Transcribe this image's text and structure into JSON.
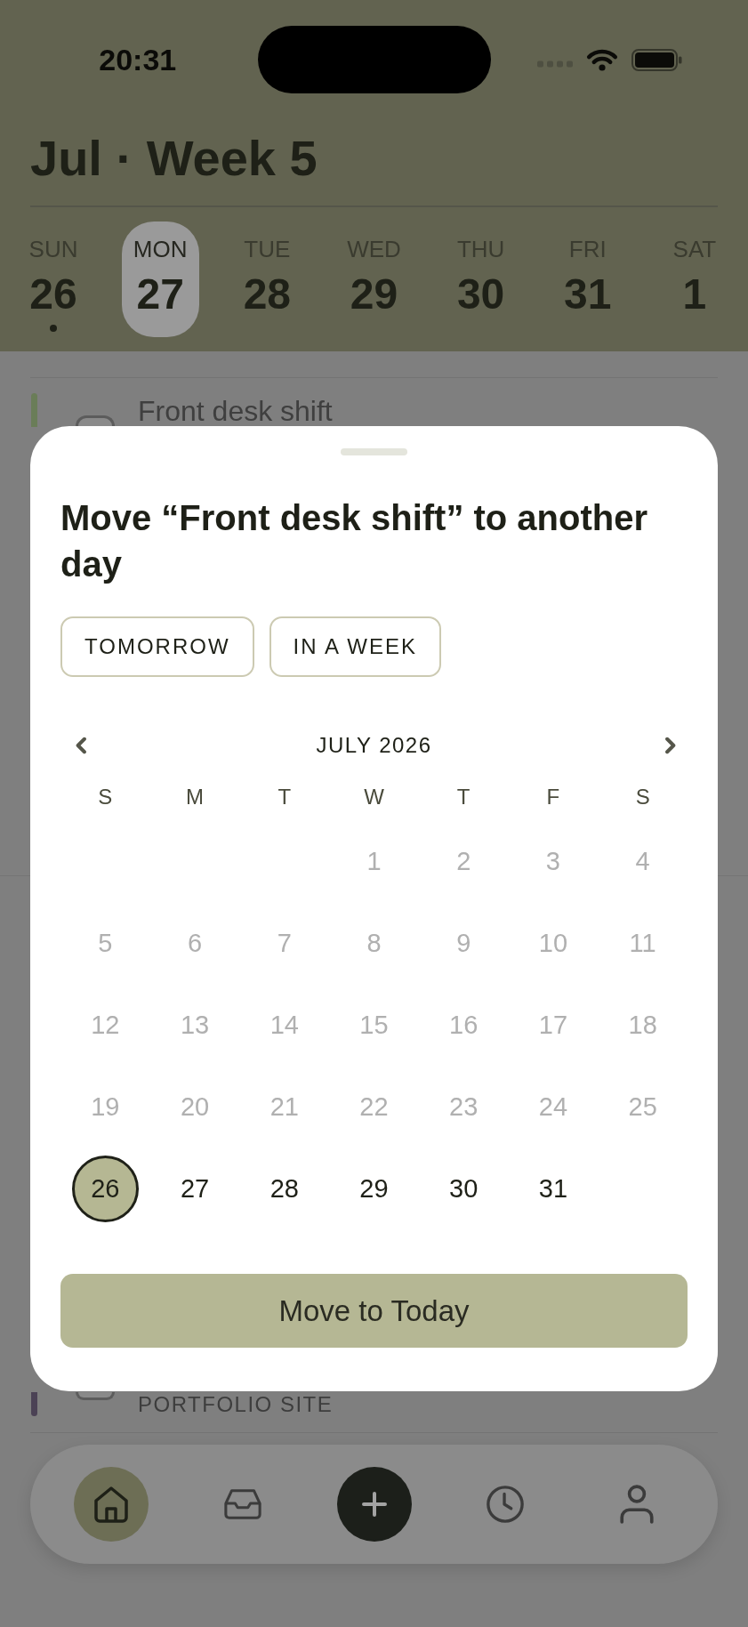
{
  "status_bar": {
    "time": "20:31"
  },
  "header": {
    "title": "Jul · Week 5",
    "days": [
      {
        "label": "SUN",
        "number": "26",
        "selected": false,
        "marked": true
      },
      {
        "label": "MON",
        "number": "27",
        "selected": true,
        "marked": false
      },
      {
        "label": "TUE",
        "number": "28",
        "selected": false,
        "marked": false
      },
      {
        "label": "WED",
        "number": "29",
        "selected": false,
        "marked": false
      },
      {
        "label": "THU",
        "number": "30",
        "selected": false,
        "marked": false
      },
      {
        "label": "FRI",
        "number": "31",
        "selected": false,
        "marked": false
      },
      {
        "label": "SAT",
        "number": "1",
        "selected": false,
        "marked": false
      }
    ]
  },
  "agenda": {
    "tasks": [
      {
        "title": "Front desk shift",
        "color": "#6a7d58",
        "checked": false
      },
      {
        "project": "PORTFOLIO SITE",
        "color": "#4b4255",
        "checked": false
      }
    ]
  },
  "move_sheet": {
    "title": "Move “Front desk shift” to another day",
    "quick_options": [
      {
        "label": "TOMORROW"
      },
      {
        "label": "IN A WEEK"
      }
    ],
    "calendar": {
      "month": "JULY 2026",
      "weekdays": [
        "S",
        "M",
        "T",
        "W",
        "T",
        "F",
        "S"
      ],
      "weeks": [
        {
          "days": [
            {
              "day": "1",
              "disabled": true,
              "selected": false
            },
            {
              "day": "2",
              "disabled": true,
              "selected": false
            },
            {
              "day": "3",
              "disabled": true,
              "selected": false
            },
            {
              "day": "4",
              "disabled": true,
              "selected": false
            }
          ]
        },
        {
          "days": [
            {
              "day": "5",
              "disabled": true,
              "selected": false
            },
            {
              "day": "6",
              "disabled": true,
              "selected": false
            },
            {
              "day": "7",
              "disabled": true,
              "selected": false
            },
            {
              "day": "8",
              "disabled": true,
              "selected": false
            },
            {
              "day": "9",
              "disabled": true,
              "selected": false
            },
            {
              "day": "10",
              "disabled": true,
              "selected": false
            },
            {
              "day": "11",
              "disabled": true,
              "selected": false
            }
          ]
        },
        {
          "days": [
            {
              "day": "12",
              "disabled": true,
              "selected": false
            },
            {
              "day": "13",
              "disabled": true,
              "selected": false
            },
            {
              "day": "14",
              "disabled": true,
              "selected": false
            },
            {
              "day": "15",
              "disabled": true,
              "selected": false
            },
            {
              "day": "16",
              "disabled": true,
              "selected": false
            },
            {
              "day": "17",
              "disabled": true,
              "selected": false
            },
            {
              "day": "18",
              "disabled": true,
              "selected": false
            }
          ]
        },
        {
          "days": [
            {
              "day": "19",
              "disabled": true,
              "selected": false
            },
            {
              "day": "20",
              "disabled": true,
              "selected": false
            },
            {
              "day": "21",
              "disabled": true,
              "selected": false
            },
            {
              "day": "22",
              "disabled": true,
              "selected": false
            },
            {
              "day": "23",
              "disabled": true,
              "selected": false
            },
            {
              "day": "24",
              "disabled": true,
              "selected": false
            },
            {
              "day": "25",
              "disabled": true,
              "selected": false
            }
          ]
        },
        {
          "days": [
            {
              "day": "26",
              "disabled": false,
              "selected": true
            },
            {
              "day": "27",
              "disabled": false,
              "selected": false
            },
            {
              "day": "28",
              "disabled": false,
              "selected": false
            },
            {
              "day": "29",
              "disabled": false,
              "selected": false
            },
            {
              "day": "30",
              "disabled": false,
              "selected": false
            },
            {
              "day": "31",
              "disabled": false,
              "selected": false
            }
          ]
        }
      ]
    },
    "confirm_button": "Move to Today"
  },
  "tab_bar": {
    "items": [
      {
        "kind": "home",
        "selected": true
      },
      {
        "kind": "inbox",
        "selected": false
      },
      {
        "kind": "add"
      },
      {
        "kind": "history",
        "selected": false
      },
      {
        "kind": "profile",
        "selected": false
      }
    ]
  }
}
